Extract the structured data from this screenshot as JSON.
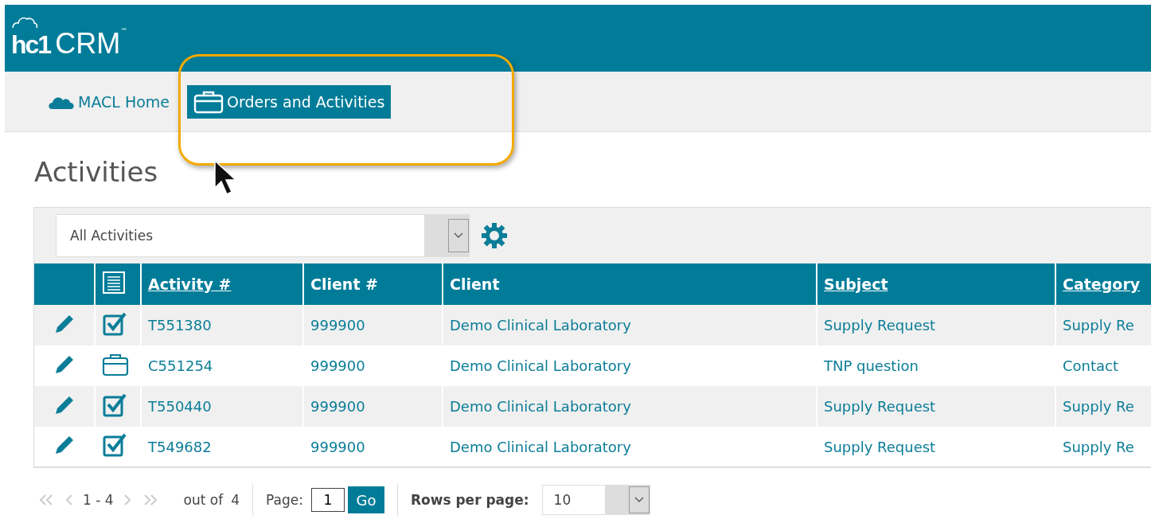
{
  "logo": {
    "mark": "hc1",
    "name": "CRM",
    "tm": "™"
  },
  "nav": [
    {
      "label": "MACL Home",
      "selected": false
    },
    {
      "label": "Orders and Activities",
      "selected": true
    }
  ],
  "page_title": "Activities",
  "filter": {
    "value": "All Activities"
  },
  "table": {
    "columns": [
      {
        "label": "Activity #",
        "sortable": true
      },
      {
        "label": "Client #",
        "sortable": false
      },
      {
        "label": "Client",
        "sortable": false
      },
      {
        "label": "Subject",
        "sortable": true
      },
      {
        "label": "Category",
        "sortable": true
      }
    ],
    "rows": [
      {
        "kind": "task",
        "cells": [
          "T551380",
          "999900",
          "Demo Clinical Laboratory",
          "Supply Request",
          "Supply Re"
        ]
      },
      {
        "kind": "order",
        "cells": [
          "C551254",
          "999900",
          "Demo Clinical Laboratory",
          "TNP question",
          "Contact"
        ]
      },
      {
        "kind": "task",
        "cells": [
          "T550440",
          "999900",
          "Demo Clinical Laboratory",
          "Supply Request",
          "Supply Re"
        ]
      },
      {
        "kind": "task",
        "cells": [
          "T549682",
          "999900",
          "Demo Clinical Laboratory",
          "Supply Request",
          "Supply Re"
        ]
      }
    ]
  },
  "pager": {
    "range": "1 - 4",
    "out_of_label": "out of",
    "total": "4",
    "page_label": "Page:",
    "page": "1",
    "go": "Go",
    "rows_label": "Rows per page:",
    "rows_per_page": "10"
  }
}
